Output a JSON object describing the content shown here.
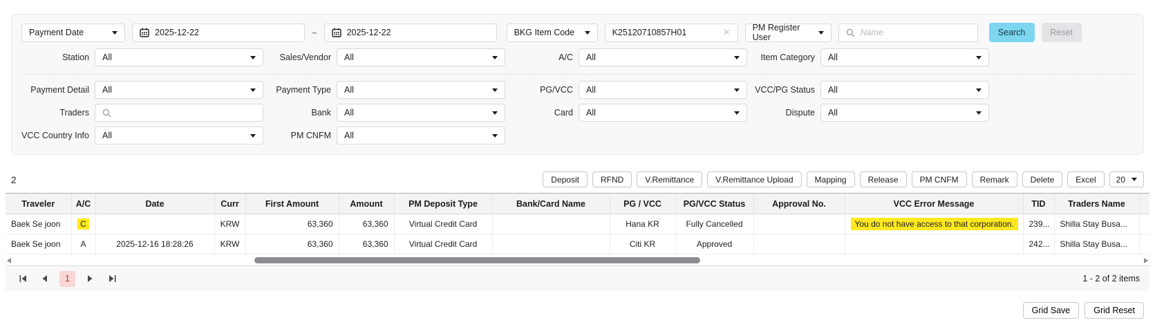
{
  "colors": {
    "accent": "#7dd5ef",
    "highlight": "#ffe81f",
    "active_page_bg": "#f8d7d4",
    "active_page_text": "#b03a30"
  },
  "filters": {
    "primary": {
      "date_type": "Payment Date",
      "date_from": "2025-12-22",
      "range_separator": "~",
      "date_to": "2025-12-22",
      "code_type": "BKG Item Code",
      "code_value": "K25120710857H01",
      "user_type": "PM Register User",
      "name_placeholder": "Name",
      "search_label": "Search",
      "reset_label": "Reset"
    },
    "fields": [
      {
        "label": "Station",
        "value": "All"
      },
      {
        "label": "Sales/Vendor",
        "value": "All"
      },
      {
        "label": "A/C",
        "value": "All"
      },
      {
        "label": "Item Category",
        "value": "All"
      },
      {
        "label": "Payment Detail",
        "value": "All"
      },
      {
        "label": "Payment Type",
        "value": "All"
      },
      {
        "label": "PG/VCC",
        "value": "All"
      },
      {
        "label": "VCC/PG Status",
        "value": "All"
      },
      {
        "label": "Traders",
        "value": ""
      },
      {
        "label": "Bank",
        "value": "All"
      },
      {
        "label": "Card",
        "value": "All"
      },
      {
        "label": "Dispute",
        "value": "All"
      },
      {
        "label": "VCC Country Info",
        "value": "All"
      },
      {
        "label": "PM CNFM",
        "value": "All"
      }
    ]
  },
  "toolbar": {
    "result_count": "2",
    "buttons": [
      "Deposit",
      "RFND",
      "V.Remittance",
      "V.Remittance Upload",
      "Mapping",
      "Release",
      "PM CNFM",
      "Remark",
      "Delete",
      "Excel"
    ],
    "page_size": "20"
  },
  "table": {
    "columns": [
      "Traveler",
      "A/C",
      "Date",
      "Curr",
      "First Amount",
      "Amount",
      "PM Deposit Type",
      "Bank/Card Name",
      "PG / VCC",
      "PG/VCC Status",
      "Approval No.",
      "VCC Error Message",
      "TID",
      "Traders Name"
    ],
    "rows": [
      {
        "traveler": "Baek Se joon",
        "ac": "C",
        "date": "",
        "curr": "KRW",
        "first_amount": "63,360",
        "amount": "63,360",
        "pm_deposit_type": "Virtual Credit Card",
        "bank_card_name": "",
        "pg_vcc": "Hana KR",
        "pg_vcc_status": "Fully Cancelled",
        "approval_no": "",
        "vcc_error_message": "You do not have access to that corporation.",
        "tid": "239...",
        "traders_name": "Shilla Stay Busa..."
      },
      {
        "traveler": "Baek Se joon",
        "ac": "A",
        "date": "2025-12-16 18:28:26",
        "curr": "KRW",
        "first_amount": "63,360",
        "amount": "63,360",
        "pm_deposit_type": "Virtual Credit Card",
        "bank_card_name": "",
        "pg_vcc": "Citi KR",
        "pg_vcc_status": "Approved",
        "approval_no": "",
        "vcc_error_message": "",
        "tid": "242...",
        "traders_name": "Shilla Stay Busa..."
      }
    ]
  },
  "pager": {
    "page": "1",
    "summary": "1 - 2 of 2 items"
  },
  "footer": {
    "grid_save": "Grid Save",
    "grid_reset": "Grid Reset"
  }
}
